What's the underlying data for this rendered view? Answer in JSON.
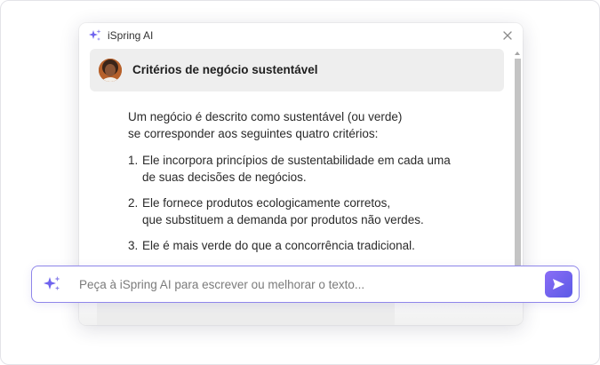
{
  "panel": {
    "header_title": "iSpring AI",
    "card_title": "Critérios de negócio sustentável",
    "intro_line1": "Um negócio é descrito como sustentável (ou verde)",
    "intro_line2": "se corresponder aos seguintes quatro critérios:",
    "criteria": [
      {
        "num": "1.",
        "line1": "Ele incorpora princípios de sustentabilidade em cada uma",
        "line2": "de suas decisões de negócios."
      },
      {
        "num": "2.",
        "line1": "Ele fornece produtos ecologicamente corretos,",
        "line2": "que substituem a demanda por produtos não verdes."
      },
      {
        "num": "3.",
        "line1": "Ele é mais verde do que a concorrência tradicional.",
        "line2": ""
      }
    ]
  },
  "prompt": {
    "placeholder": "Peça à iSpring AI para escrever ou melhorar o texto..."
  },
  "icons": {
    "header": "sparkle-icon",
    "close": "close-icon",
    "prompt": "sparkle-icon",
    "send": "send-icon"
  },
  "colors": {
    "accent": "#6f63ee",
    "prompt_border": "#8f86ea",
    "card_bg": "#eeeeee"
  }
}
